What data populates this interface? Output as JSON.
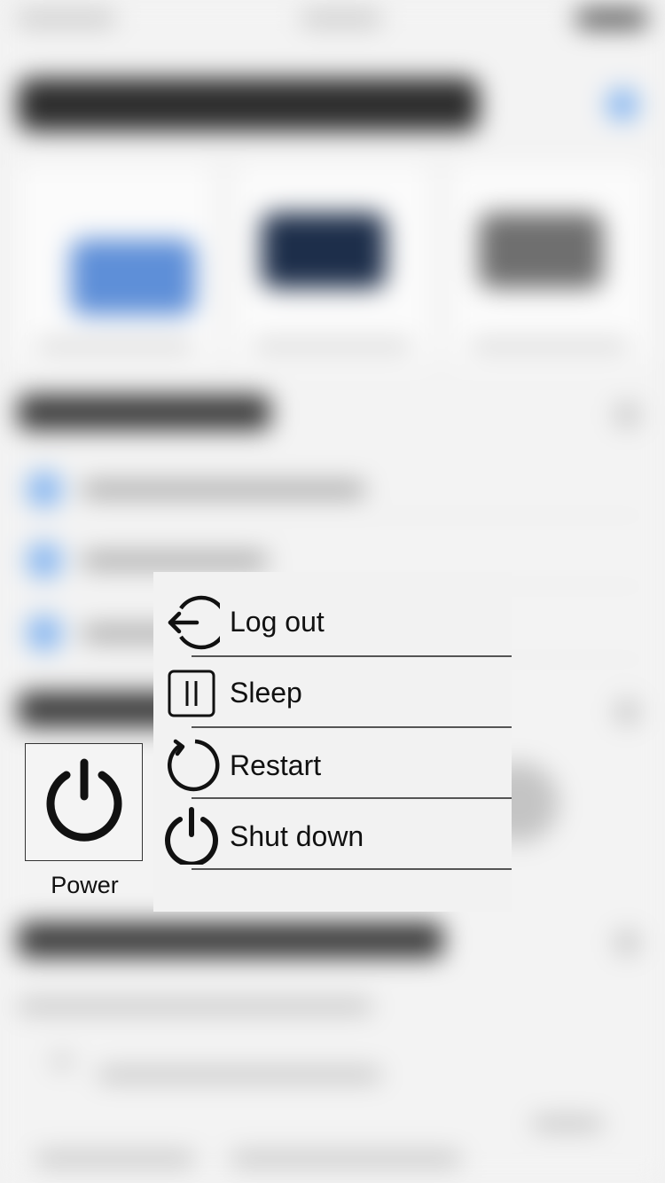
{
  "power_tile": {
    "icon": "power-icon",
    "label": "Power"
  },
  "power_menu": {
    "items": [
      {
        "label": "Log out",
        "icon": "log-out-icon"
      },
      {
        "label": "Sleep",
        "icon": "sleep-icon"
      },
      {
        "label": "Restart",
        "icon": "restart-icon"
      },
      {
        "label": "Shut down",
        "icon": "shut-down-icon"
      }
    ]
  },
  "colors": {
    "icon_stroke": "#111111",
    "menu_background": "#f2f2f2",
    "separator": "#555555",
    "background_accent_blue": "#7fb2f0"
  }
}
